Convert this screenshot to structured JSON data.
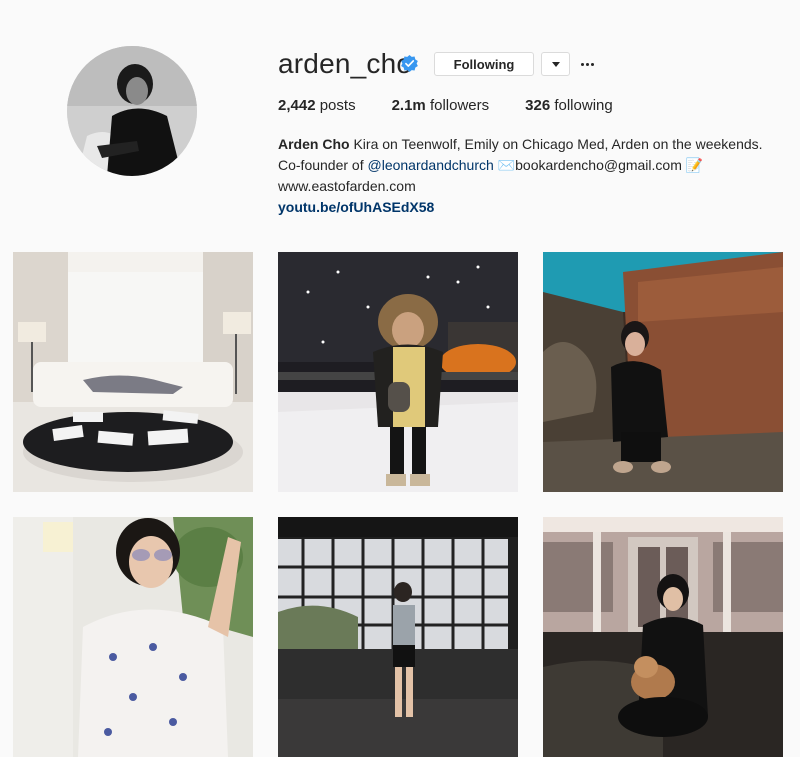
{
  "profile": {
    "username": "arden_cho",
    "verified_icon": "verified-badge-icon",
    "follow_label": "Following",
    "stats": {
      "posts_count": "2,442",
      "posts_label": "posts",
      "followers_count": "2.1m",
      "followers_label": "followers",
      "following_count": "326",
      "following_label": "following"
    },
    "bio": {
      "name": "Arden Cho",
      "line1": "Kira on Teenwolf, Emily on Chicago Med, Arden on the weekends.",
      "line2_prefix": "Co-founder of ",
      "mention": "@leonardandchurch",
      "email": "bookardencho@gmail.com",
      "website": "www.eastofarden.com",
      "link": "youtu.be/ofUhASEdX58"
    }
  },
  "grid": {
    "posts": [
      {
        "icon": "photo-living-room"
      },
      {
        "icon": "photo-snow-night"
      },
      {
        "icon": "photo-rusty-wall"
      },
      {
        "icon": "photo-sunglasses-wave"
      },
      {
        "icon": "photo-studio-window"
      },
      {
        "icon": "photo-dog-night"
      }
    ]
  },
  "colors": {
    "background": "#fafafa",
    "text": "#262626",
    "link": "#003569",
    "verified": "#3897f0",
    "border": "#dbdbdb"
  }
}
